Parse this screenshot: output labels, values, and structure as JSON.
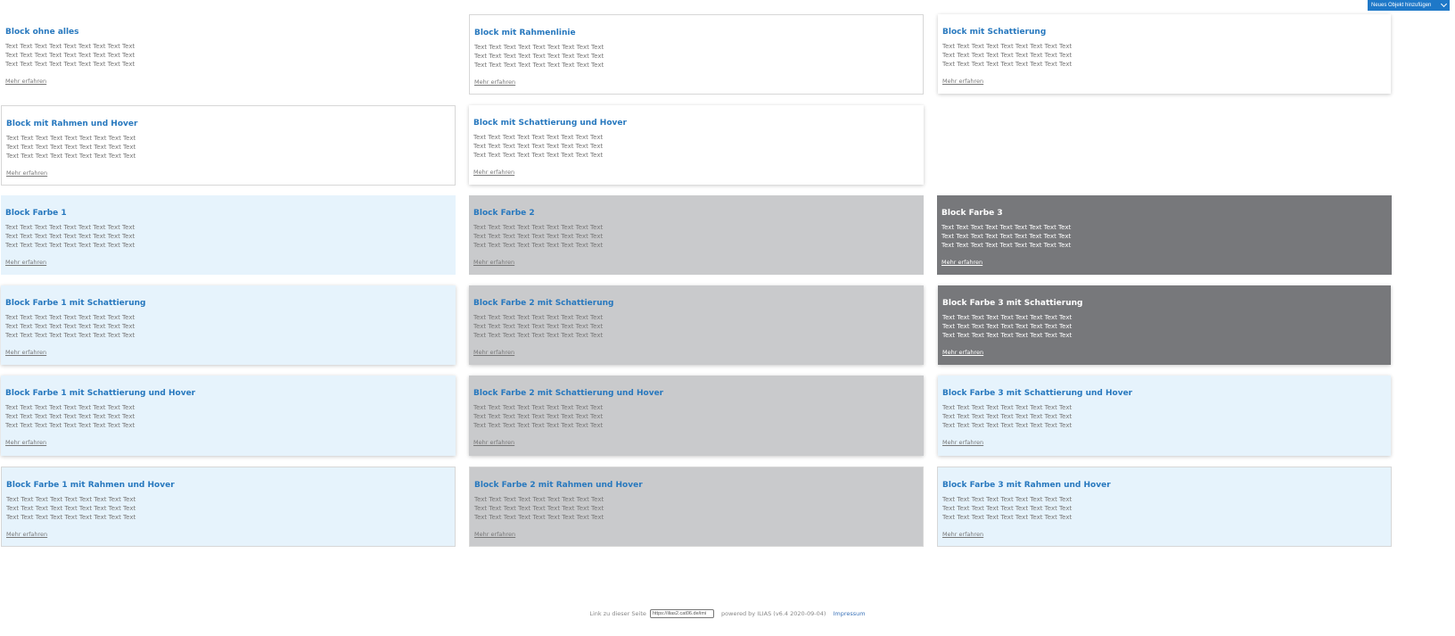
{
  "toolbar": {
    "add_object_label": "Neues Objekt hinzufügen"
  },
  "blocks": [
    {
      "title": "Block ohne alles",
      "text": "Text Text Text Text Text Text Text Text Text Text Text Text Text Text Text Text Text Text Text Text Text Text Text Text Text Text Text",
      "link": "Mehr erfahren"
    },
    {
      "title": "Block mit Rahmenlinie",
      "text": "Text Text Text Text Text Text Text Text Text Text Text Text Text Text Text Text Text Text Text Text Text Text Text Text Text Text Text",
      "link": "Mehr erfahren"
    },
    {
      "title": "Block mit Schattierung",
      "text": "Text Text Text Text Text Text Text Text Text Text Text Text Text Text Text Text Text Text Text Text Text Text Text Text Text Text Text",
      "link": "Mehr erfahren"
    },
    {
      "title": "Block mit Rahmen und Hover",
      "text": "Text Text Text Text Text Text Text Text Text Text Text Text Text Text Text Text Text Text Text Text Text Text Text Text Text Text Text",
      "link": "Mehr erfahren"
    },
    {
      "title": "Block mit Schattierung und Hover",
      "text": "Text Text Text Text Text Text Text Text Text Text Text Text Text Text Text Text Text Text Text Text Text Text Text Text Text Text Text",
      "link": "Mehr erfahren"
    },
    {
      "title": "Block Farbe 1",
      "text": "Text Text Text Text Text Text Text Text Text Text Text Text Text Text Text Text Text Text Text Text Text Text Text Text Text Text Text",
      "link": "Mehr erfahren"
    },
    {
      "title": "Block Farbe 2",
      "text": "Text Text Text Text Text Text Text Text Text Text Text Text Text Text Text Text Text Text Text Text Text Text Text Text Text Text Text",
      "link": "Mehr erfahren"
    },
    {
      "title": "Block Farbe 3",
      "text": "Text Text Text Text Text Text Text Text Text Text Text Text Text Text Text Text Text Text Text Text Text Text Text Text Text Text Text",
      "link": "Mehr erfahren"
    },
    {
      "title": "Block Farbe 1 mit Schattierung",
      "text": "Text Text Text Text Text Text Text Text Text Text Text Text Text Text Text Text Text Text Text Text Text Text Text Text Text Text Text",
      "link": "Mehr erfahren"
    },
    {
      "title": "Block Farbe 2 mit Schattierung",
      "text": "Text Text Text Text Text Text Text Text Text Text Text Text Text Text Text Text Text Text Text Text Text Text Text Text Text Text Text",
      "link": "Mehr erfahren"
    },
    {
      "title": "Block Farbe 3 mit Schattierung",
      "text": "Text Text Text Text Text Text Text Text Text Text Text Text Text Text Text Text Text Text Text Text Text Text Text Text Text Text Text",
      "link": "Mehr erfahren"
    },
    {
      "title": "Block Farbe 1 mit Schattierung und Hover",
      "text": "Text Text Text Text Text Text Text Text Text Text Text Text Text Text Text Text Text Text Text Text Text Text Text Text Text Text Text",
      "link": "Mehr erfahren"
    },
    {
      "title": "Block Farbe 2 mit Schattierung und Hover",
      "text": "Text Text Text Text Text Text Text Text Text Text Text Text Text Text Text Text Text Text Text Text Text Text Text Text Text Text Text",
      "link": "Mehr erfahren"
    },
    {
      "title": "Block Farbe 3 mit Schattierung und Hover",
      "text": "Text Text Text Text Text Text Text Text Text Text Text Text Text Text Text Text Text Text Text Text Text Text Text Text Text Text Text",
      "link": "Mehr erfahren"
    },
    {
      "title": "Block Farbe 1 mit Rahmen und Hover",
      "text": "Text Text Text Text Text Text Text Text Text Text Text Text Text Text Text Text Text Text Text Text Text Text Text Text Text Text Text",
      "link": "Mehr erfahren"
    },
    {
      "title": "Block Farbe 2 mit Rahmen und Hover",
      "text": "Text Text Text Text Text Text Text Text Text Text Text Text Text Text Text Text Text Text Text Text Text Text Text Text Text Text Text",
      "link": "Mehr erfahren"
    },
    {
      "title": "Block Farbe 3 mit Rahmen und Hover",
      "text": "Text Text Text Text Text Text Text Text Text Text Text Text Text Text Text Text Text Text Text Text Text Text Text Text Text Text Text",
      "link": "Mehr erfahren"
    }
  ],
  "footer": {
    "permalink_label": "Link zu dieser Seite",
    "permalink_value": "https://ilias2.cat06.de/imi",
    "powered_by": "powered by ILIAS (v6.4 2020-09-04)",
    "impressum": "Impressum"
  },
  "colors": {
    "accent": "#1e78c8",
    "title": "#2778be",
    "farbe_1": "#e6f3fc",
    "farbe_2": "#c9cacc",
    "farbe_3": "#77787b"
  }
}
